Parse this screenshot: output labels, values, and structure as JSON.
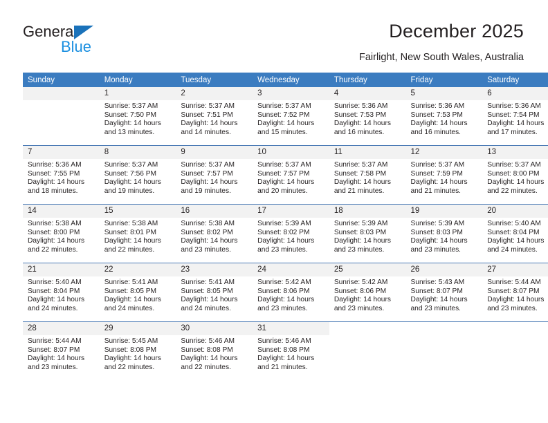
{
  "brand": {
    "name_top": "General",
    "name_bottom": "Blue",
    "triangle_color": "#1a72ba",
    "blue_text_color": "#1a8fe0"
  },
  "header": {
    "title": "December 2025",
    "subtitle": "Fairlight, New South Wales, Australia"
  },
  "theme": {
    "header_blue": "#3b7cc0",
    "daynum_gray": "#f2f2f2",
    "row_line": "#4b7bb5",
    "text": "#231f20"
  },
  "weekdays": [
    "Sunday",
    "Monday",
    "Tuesday",
    "Wednesday",
    "Thursday",
    "Friday",
    "Saturday"
  ],
  "labels": {
    "sunrise_prefix": "Sunrise:",
    "sunset_prefix": "Sunset:",
    "daylight_prefix": "Daylight:"
  },
  "weeks": [
    [
      {
        "day": "",
        "lines": []
      },
      {
        "day": "1",
        "lines": [
          "Sunrise: 5:37 AM",
          "Sunset: 7:50 PM",
          "Daylight: 14 hours",
          "and 13 minutes."
        ]
      },
      {
        "day": "2",
        "lines": [
          "Sunrise: 5:37 AM",
          "Sunset: 7:51 PM",
          "Daylight: 14 hours",
          "and 14 minutes."
        ]
      },
      {
        "day": "3",
        "lines": [
          "Sunrise: 5:37 AM",
          "Sunset: 7:52 PM",
          "Daylight: 14 hours",
          "and 15 minutes."
        ]
      },
      {
        "day": "4",
        "lines": [
          "Sunrise: 5:36 AM",
          "Sunset: 7:53 PM",
          "Daylight: 14 hours",
          "and 16 minutes."
        ]
      },
      {
        "day": "5",
        "lines": [
          "Sunrise: 5:36 AM",
          "Sunset: 7:53 PM",
          "Daylight: 14 hours",
          "and 16 minutes."
        ]
      },
      {
        "day": "6",
        "lines": [
          "Sunrise: 5:36 AM",
          "Sunset: 7:54 PM",
          "Daylight: 14 hours",
          "and 17 minutes."
        ]
      }
    ],
    [
      {
        "day": "7",
        "lines": [
          "Sunrise: 5:36 AM",
          "Sunset: 7:55 PM",
          "Daylight: 14 hours",
          "and 18 minutes."
        ]
      },
      {
        "day": "8",
        "lines": [
          "Sunrise: 5:37 AM",
          "Sunset: 7:56 PM",
          "Daylight: 14 hours",
          "and 19 minutes."
        ]
      },
      {
        "day": "9",
        "lines": [
          "Sunrise: 5:37 AM",
          "Sunset: 7:57 PM",
          "Daylight: 14 hours",
          "and 19 minutes."
        ]
      },
      {
        "day": "10",
        "lines": [
          "Sunrise: 5:37 AM",
          "Sunset: 7:57 PM",
          "Daylight: 14 hours",
          "and 20 minutes."
        ]
      },
      {
        "day": "11",
        "lines": [
          "Sunrise: 5:37 AM",
          "Sunset: 7:58 PM",
          "Daylight: 14 hours",
          "and 21 minutes."
        ]
      },
      {
        "day": "12",
        "lines": [
          "Sunrise: 5:37 AM",
          "Sunset: 7:59 PM",
          "Daylight: 14 hours",
          "and 21 minutes."
        ]
      },
      {
        "day": "13",
        "lines": [
          "Sunrise: 5:37 AM",
          "Sunset: 8:00 PM",
          "Daylight: 14 hours",
          "and 22 minutes."
        ]
      }
    ],
    [
      {
        "day": "14",
        "lines": [
          "Sunrise: 5:38 AM",
          "Sunset: 8:00 PM",
          "Daylight: 14 hours",
          "and 22 minutes."
        ]
      },
      {
        "day": "15",
        "lines": [
          "Sunrise: 5:38 AM",
          "Sunset: 8:01 PM",
          "Daylight: 14 hours",
          "and 22 minutes."
        ]
      },
      {
        "day": "16",
        "lines": [
          "Sunrise: 5:38 AM",
          "Sunset: 8:02 PM",
          "Daylight: 14 hours",
          "and 23 minutes."
        ]
      },
      {
        "day": "17",
        "lines": [
          "Sunrise: 5:39 AM",
          "Sunset: 8:02 PM",
          "Daylight: 14 hours",
          "and 23 minutes."
        ]
      },
      {
        "day": "18",
        "lines": [
          "Sunrise: 5:39 AM",
          "Sunset: 8:03 PM",
          "Daylight: 14 hours",
          "and 23 minutes."
        ]
      },
      {
        "day": "19",
        "lines": [
          "Sunrise: 5:39 AM",
          "Sunset: 8:03 PM",
          "Daylight: 14 hours",
          "and 23 minutes."
        ]
      },
      {
        "day": "20",
        "lines": [
          "Sunrise: 5:40 AM",
          "Sunset: 8:04 PM",
          "Daylight: 14 hours",
          "and 24 minutes."
        ]
      }
    ],
    [
      {
        "day": "21",
        "lines": [
          "Sunrise: 5:40 AM",
          "Sunset: 8:04 PM",
          "Daylight: 14 hours",
          "and 24 minutes."
        ]
      },
      {
        "day": "22",
        "lines": [
          "Sunrise: 5:41 AM",
          "Sunset: 8:05 PM",
          "Daylight: 14 hours",
          "and 24 minutes."
        ]
      },
      {
        "day": "23",
        "lines": [
          "Sunrise: 5:41 AM",
          "Sunset: 8:05 PM",
          "Daylight: 14 hours",
          "and 24 minutes."
        ]
      },
      {
        "day": "24",
        "lines": [
          "Sunrise: 5:42 AM",
          "Sunset: 8:06 PM",
          "Daylight: 14 hours",
          "and 23 minutes."
        ]
      },
      {
        "day": "25",
        "lines": [
          "Sunrise: 5:42 AM",
          "Sunset: 8:06 PM",
          "Daylight: 14 hours",
          "and 23 minutes."
        ]
      },
      {
        "day": "26",
        "lines": [
          "Sunrise: 5:43 AM",
          "Sunset: 8:07 PM",
          "Daylight: 14 hours",
          "and 23 minutes."
        ]
      },
      {
        "day": "27",
        "lines": [
          "Sunrise: 5:44 AM",
          "Sunset: 8:07 PM",
          "Daylight: 14 hours",
          "and 23 minutes."
        ]
      }
    ],
    [
      {
        "day": "28",
        "lines": [
          "Sunrise: 5:44 AM",
          "Sunset: 8:07 PM",
          "Daylight: 14 hours",
          "and 23 minutes."
        ]
      },
      {
        "day": "29",
        "lines": [
          "Sunrise: 5:45 AM",
          "Sunset: 8:08 PM",
          "Daylight: 14 hours",
          "and 22 minutes."
        ]
      },
      {
        "day": "30",
        "lines": [
          "Sunrise: 5:46 AM",
          "Sunset: 8:08 PM",
          "Daylight: 14 hours",
          "and 22 minutes."
        ]
      },
      {
        "day": "31",
        "lines": [
          "Sunrise: 5:46 AM",
          "Sunset: 8:08 PM",
          "Daylight: 14 hours",
          "and 21 minutes."
        ]
      },
      {
        "day": "",
        "lines": []
      },
      {
        "day": "",
        "lines": []
      },
      {
        "day": "",
        "lines": []
      }
    ]
  ]
}
